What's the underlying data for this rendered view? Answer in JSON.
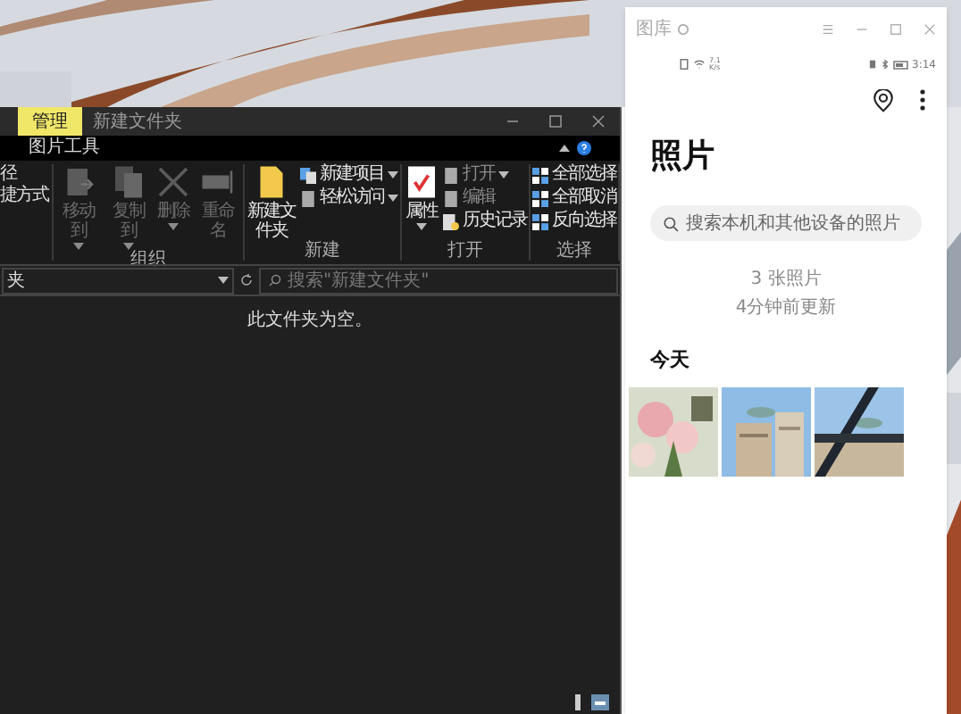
{
  "explorer": {
    "context_tab": "管理",
    "title": "新建文件夹",
    "ribbon_tab": "图片工具",
    "clipped_items": [
      "径",
      "捷方式"
    ],
    "groups": [
      {
        "label": "组织",
        "items": [
          {
            "kind": "large",
            "label": "移动到",
            "disabled": true,
            "dropdown": true
          },
          {
            "kind": "large",
            "label": "复制到",
            "disabled": true,
            "dropdown": true
          },
          {
            "kind": "large",
            "label": "删除",
            "disabled": true,
            "dropdown": true
          },
          {
            "kind": "large",
            "label": "重命名",
            "disabled": true,
            "dropdown": false
          }
        ]
      },
      {
        "label": "新建",
        "items": [
          {
            "kind": "large",
            "label": "新建文件夹",
            "disabled": false,
            "dropdown": false
          },
          {
            "kind": "small",
            "label": "新建项目",
            "disabled": false,
            "dropdown": true
          },
          {
            "kind": "small",
            "label": "轻松访问",
            "disabled": false,
            "dropdown": true
          }
        ]
      },
      {
        "label": "打开",
        "items": [
          {
            "kind": "large",
            "label": "属性",
            "disabled": false,
            "dropdown": true
          },
          {
            "kind": "small",
            "label": "打开",
            "disabled": true,
            "dropdown": true
          },
          {
            "kind": "small",
            "label": "编辑",
            "disabled": true,
            "dropdown": false
          },
          {
            "kind": "small",
            "label": "历史记录",
            "disabled": false,
            "dropdown": false
          }
        ]
      },
      {
        "label": "选择",
        "items": [
          {
            "kind": "small",
            "label": "全部选择",
            "disabled": false,
            "dropdown": false
          },
          {
            "kind": "small",
            "label": "全部取消",
            "disabled": false,
            "dropdown": false
          },
          {
            "kind": "small",
            "label": "反向选择",
            "disabled": false,
            "dropdown": false
          }
        ]
      }
    ],
    "address": {
      "path": "夹"
    },
    "search": {
      "placeholder": "搜索\"新建文件夹\""
    },
    "empty_message": "此文件夹为空。"
  },
  "gallery": {
    "app_title": "图库",
    "status": {
      "speed": [
        "7.1",
        "K/s"
      ],
      "time": "3:14"
    },
    "heading": "照片",
    "search": {
      "placeholder": "搜索本机和其他设备的照片"
    },
    "summary": [
      "3 张照片",
      "4分钟前更新"
    ],
    "section": "今天",
    "photos": [
      {
        "kind": "picture"
      },
      {
        "kind": "picture"
      },
      {
        "kind": "picture"
      }
    ]
  }
}
